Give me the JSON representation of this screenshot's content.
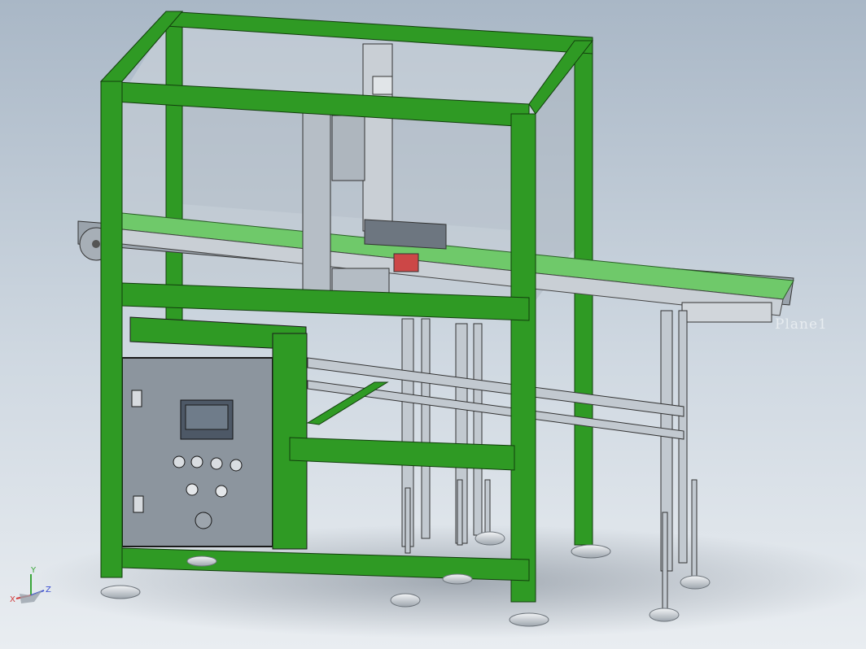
{
  "viewport": {
    "plane_label": "Plane1",
    "triad": {
      "x_label": "X",
      "y_label": "Y",
      "z_label": "Z"
    }
  },
  "colors": {
    "frame_green": "#2f9a24",
    "frame_green_dark": "#1d6e16",
    "belt_green": "#6fc96a",
    "aluminum": "#b9c1c9",
    "glass": "#c4ccd4",
    "cabinet_panel": "#8c959e",
    "hmi_screen": "#4d5866",
    "axis_x": "#d23b3b",
    "axis_y": "#3aa63a",
    "axis_z": "#3b4fd2"
  }
}
